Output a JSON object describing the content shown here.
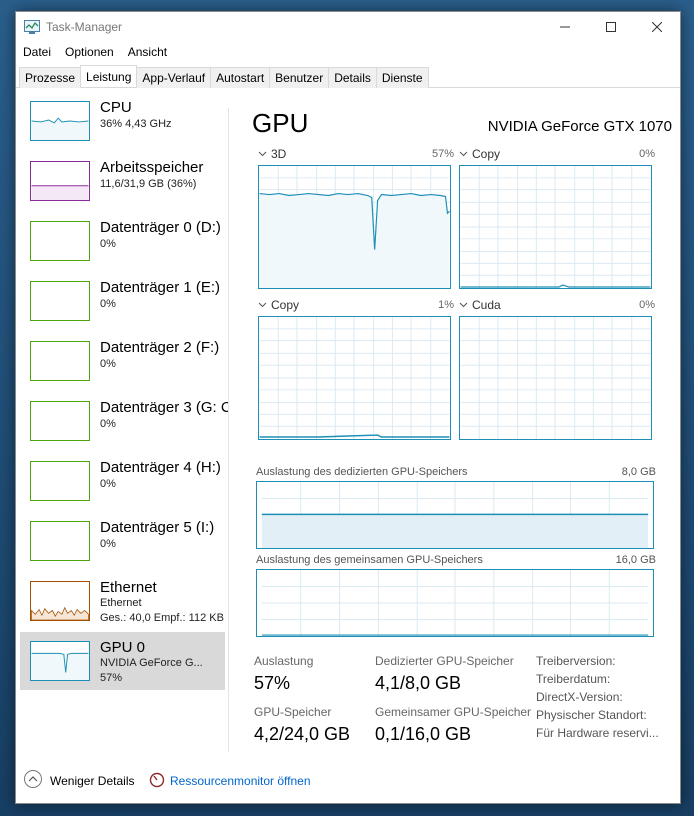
{
  "window": {
    "title": "Task-Manager"
  },
  "menu": [
    "Datei",
    "Optionen",
    "Ansicht"
  ],
  "tabs": [
    {
      "label": "Prozesse"
    },
    {
      "label": "Leistung"
    },
    {
      "label": "App-Verlauf"
    },
    {
      "label": "Autostart"
    },
    {
      "label": "Benutzer"
    },
    {
      "label": "Details"
    },
    {
      "label": "Dienste"
    }
  ],
  "active_tab": "Leistung",
  "sidebar": {
    "items": [
      {
        "name": "CPU",
        "sub1": "36%  4,43 GHz",
        "sub2": ""
      },
      {
        "name": "Arbeitsspeicher",
        "sub1": "11,6/31,9 GB (36%)",
        "sub2": ""
      },
      {
        "name": "Datenträger 0 (D:)",
        "sub1": "0%",
        "sub2": ""
      },
      {
        "name": "Datenträger 1 (E:)",
        "sub1": "0%",
        "sub2": ""
      },
      {
        "name": "Datenträger 2 (F:)",
        "sub1": "0%",
        "sub2": ""
      },
      {
        "name": "Datenträger 3 (G: C",
        "sub1": "0%",
        "sub2": ""
      },
      {
        "name": "Datenträger 4 (H:)",
        "sub1": "0%",
        "sub2": ""
      },
      {
        "name": "Datenträger 5 (I:)",
        "sub1": "0%",
        "sub2": ""
      },
      {
        "name": "Ethernet",
        "sub1": "Ethernet",
        "sub2": "Ges.: 40,0 Empf.: 112 KB"
      },
      {
        "name": "GPU 0",
        "sub1": "NVIDIA GeForce G...",
        "sub2": "57%"
      }
    ]
  },
  "main": {
    "title": "GPU",
    "model": "NVIDIA GeForce GTX 1070",
    "engines": [
      {
        "label": "3D",
        "pct": "57%"
      },
      {
        "label": "Copy",
        "pct": "0%"
      },
      {
        "label": "Copy",
        "pct": "1%"
      },
      {
        "label": "Cuda",
        "pct": "0%"
      }
    ],
    "dedicated_mem": {
      "label": "Auslastung des dedizierten GPU-Speichers",
      "max": "8,0 GB",
      "fraction": 0.51
    },
    "shared_mem": {
      "label": "Auslastung des gemeinsamen GPU-Speichers",
      "max": "16,0 GB",
      "fraction": 0.006
    },
    "stats": {
      "auslastung_label": "Auslastung",
      "auslastung_value": "57%",
      "dedicated_label": "Dedizierter GPU-Speicher",
      "dedicated_value": "4,1/8,0 GB",
      "gpu_mem_label": "GPU-Speicher",
      "gpu_mem_value": "4,2/24,0 GB",
      "shared_label": "Gemeinsamer GPU-Speicher",
      "shared_value": "0,1/16,0 GB"
    },
    "info": [
      "Treiberversion:",
      "Treiberdatum:",
      "DirectX-Version:",
      "Physischer Standort:",
      "Für Hardware reservi..."
    ]
  },
  "footer": {
    "less_details": "Weniger Details",
    "resource_monitor": "Ressourcenmonitor öffnen"
  },
  "colors": {
    "gpu_graph": "#1d8fb6",
    "cpu_graph": "#1d8fb6",
    "memory_graph": "#8b2a9b",
    "disk_graph": "#4da60c",
    "ethernet_graph": "#a74f01",
    "link": "#0066cc"
  }
}
